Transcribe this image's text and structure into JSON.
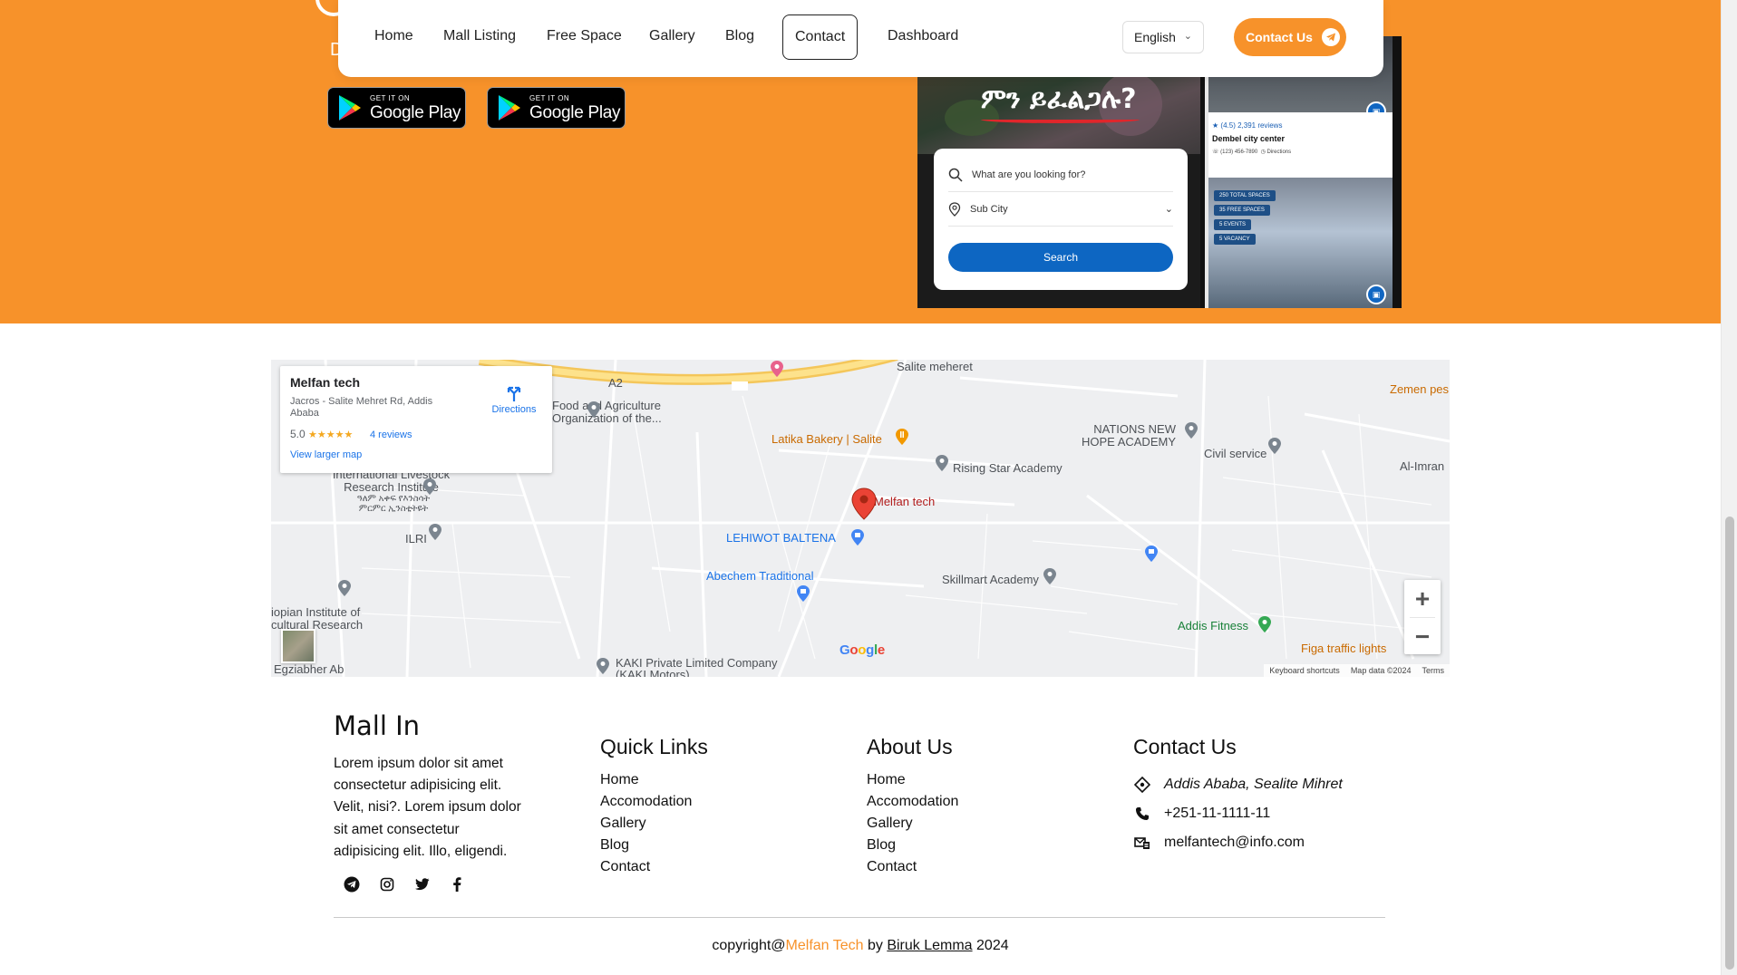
{
  "nav": {
    "items": [
      {
        "label": "Home"
      },
      {
        "label": "Mall Listing"
      },
      {
        "label": "Free Space"
      },
      {
        "label": "Gallery"
      },
      {
        "label": "Blog"
      },
      {
        "label": "Contact",
        "active": true
      },
      {
        "label": "Dashboard"
      }
    ],
    "language": "English",
    "contact_button": "Contact Us"
  },
  "hero": {
    "store_badges": [
      {
        "small": "GET IT ON",
        "big": "Google Play"
      },
      {
        "small": "GET IT ON",
        "big": "Google Play"
      }
    ],
    "partial_text": "D",
    "phone": {
      "headline": "ምን ይፈልጋሉ?",
      "search_placeholder": "What are you looking for?",
      "location_select": "Sub City",
      "search_button": "Search",
      "listing_rating": "(4.5) 2,391 reviews",
      "listing_name": "Dembel city center",
      "listing_phone": "(123) 456-7890",
      "listing_directions": "Directions",
      "tags": [
        "250 TOTAL SPACES",
        "35 FREE SPACES",
        "5 EVENTS",
        "5 VACANCY"
      ]
    }
  },
  "map": {
    "place_name": "Melfan tech",
    "place_address": "Jacros - Salite Mehret Rd, Addis Ababa",
    "rating": "5.0",
    "reviews": "4 reviews",
    "larger_map": "View larger map",
    "directions": "Directions",
    "labels": {
      "food_ag": "Food and Agriculture Organization of the...",
      "latika": "Latika Bakery | Salite",
      "salite": "Salite meheret",
      "nations": "NATIONS NEW HOPE ACADEMY",
      "civil": "Civil service",
      "rising": "Rising Star Academy",
      "melfan": "Melfan tech",
      "lehiwot": "LEHIWOT BALTENA",
      "abechem": "Abechem Traditional",
      "skillmart": "Skillmart Academy",
      "addis_fitness": "Addis Fitness",
      "figa": "Figa traffic lights",
      "kaki": "KAKI Private Limited Company (KAKI Motors)",
      "ilri": "ILRI",
      "livestock": "International Livestock Research Institute",
      "livestock_am": "ዓለም አቀፍ የእንስሳት ምርምር ኢንስቲትዩት",
      "ethiopian": "iopian Institute of cultural Research",
      "egziabher": "Egziabher Ab",
      "zemen": "Zemen pes",
      "alimran": "Al-Imran",
      "road": "A2",
      "google": "Google",
      "attrib_shortcuts": "Keyboard shortcuts",
      "attrib_data": "Map data ©2024",
      "attrib_terms": "Terms"
    }
  },
  "footer": {
    "brand": "Mall In",
    "description": "Lorem ipsum dolor sit amet consectetur adipisicing elit. Velit, nisi?. Lorem ipsum dolor sit amet consectetur adipisicing elit. Illo, eligendi.",
    "quick_links": {
      "title": "Quick Links",
      "items": [
        "Home",
        "Accomodation",
        "Gallery",
        "Blog",
        "Contact"
      ]
    },
    "about": {
      "title": "About Us",
      "items": [
        "Home",
        "Accomodation",
        "Gallery",
        "Blog",
        "Contact"
      ]
    },
    "contact": {
      "title": "Contact Us",
      "address": "Addis Ababa, Sealite Mihret",
      "phone": "+251-11-1111-11",
      "email": "melfantech@info.com"
    },
    "copyright": {
      "prefix": "copyright@",
      "brand": "Melfan Tech",
      "by": " by ",
      "author": "Biruk Lemma",
      "year": " 2024"
    }
  },
  "colors": {
    "accent": "#F7922A",
    "primary_blue": "#0D66C2"
  }
}
